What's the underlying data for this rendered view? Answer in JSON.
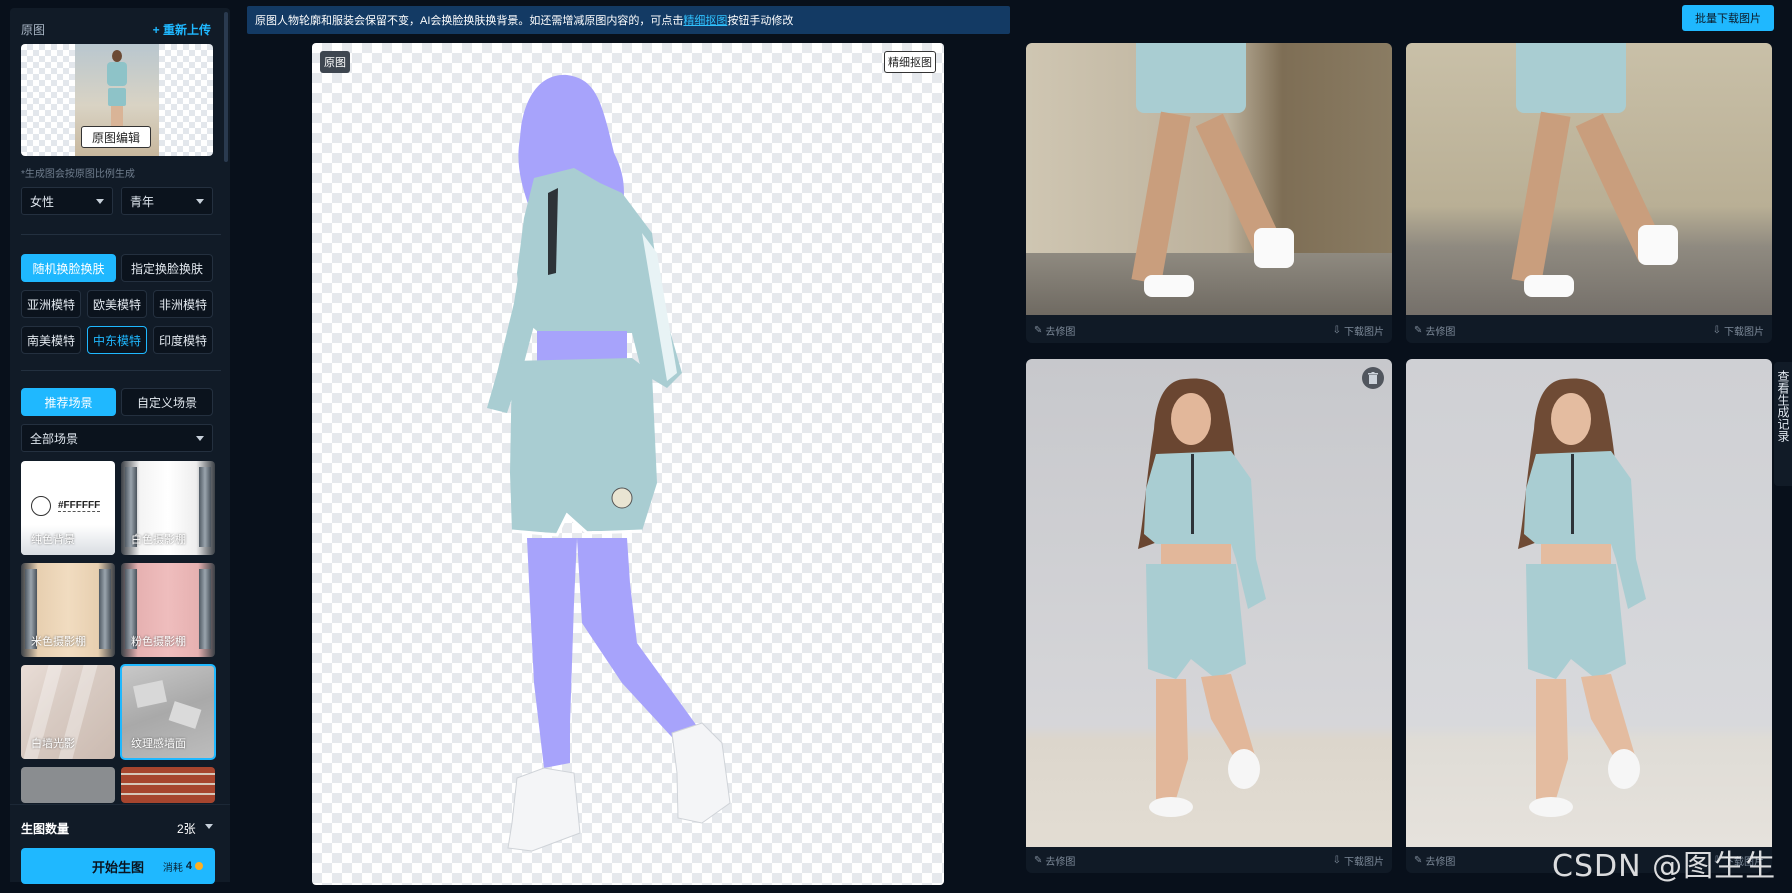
{
  "left": {
    "origin_title": "原图",
    "reupload_label": "+ 重新上传",
    "edit_button": "原图编辑",
    "ratio_note": "*生成图会按原图比例生成",
    "gender_value": "女性",
    "age_value": "青年",
    "face_tabs": [
      "随机换脸换肤",
      "指定换脸换肤"
    ],
    "models": [
      "亚洲模特",
      "欧美模特",
      "非洲模特",
      "南美模特",
      "中东模特",
      "印度模特"
    ],
    "scene_tabs": [
      "推荐场景",
      "自定义场景"
    ],
    "scene_filter": "全部场景",
    "scenes": [
      {
        "label": "纯色背景",
        "swatch_text": "#FFFFFF"
      },
      {
        "label": "白色摄影棚"
      },
      {
        "label": "米色摄影棚"
      },
      {
        "label": "粉色摄影棚"
      },
      {
        "label": "白墙光影"
      },
      {
        "label": "纹理感墙面"
      }
    ],
    "count_label": "生图数量",
    "count_value": "2张",
    "start_label": "开始生图",
    "cost_label": "消耗",
    "cost_value": "4"
  },
  "notice": {
    "text_before": "原图人物轮廓和服装会保留不变，AI会换脸换肤换背景。如还需增减原图内容的，可点击",
    "link": "精细抠图",
    "text_after": "按钮手动修改"
  },
  "canvas": {
    "tag_left": "原图",
    "tag_right": "精细抠图"
  },
  "right": {
    "batch_download": "批量下载图片",
    "retouch_label": "去修图",
    "download_label": "下载图片",
    "side_tab": "查看生成记录"
  },
  "watermark": "CSDN @图生生",
  "colors": {
    "accent": "#1fb8ff",
    "background": "#08101b",
    "panel": "#111b27"
  }
}
